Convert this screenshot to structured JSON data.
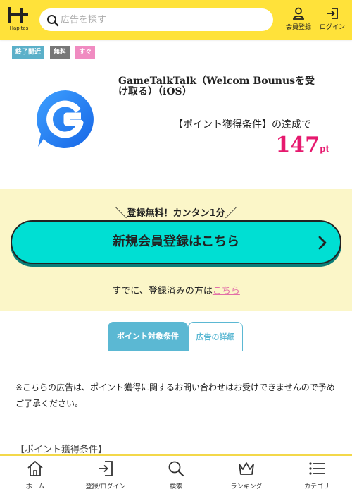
{
  "header": {
    "logo_text": "Hapitas",
    "search_placeholder": "広告を探す",
    "member_label": "会員登録",
    "login_label": "ログイン"
  },
  "badges": {
    "ending": "終了間近",
    "free": "無料",
    "instant": "すぐ"
  },
  "offer": {
    "title": "GameTalkTalk（Welcom Bounusを受け取る）（iOS）",
    "condition": "【ポイント獲得条件】の達成で",
    "points": "147",
    "unit": "pt"
  },
  "register": {
    "catch_text": "登録無料！カンタン1分",
    "slash_left": "＼",
    "slash_right": "／",
    "button_label": "新規会員登録はこちら",
    "already_text": "すでに、登録済みの方は",
    "already_link": "こちら"
  },
  "tabs": [
    {
      "label": "ポイント対象条件",
      "active": true
    },
    {
      "label": "広告の詳細",
      "active": false
    }
  ],
  "notice": "※こちらの広告は、ポイント獲得に関するお問い合わせはお受けできませんので予めご了承ください。",
  "section_heading": "【ポイント獲得条件】",
  "bottom_nav": [
    {
      "label": "ホーム",
      "icon": "home-icon"
    },
    {
      "label": "登録/ログイン",
      "icon": "login-icon"
    },
    {
      "label": "検索",
      "icon": "search-icon"
    },
    {
      "label": "ランキング",
      "icon": "crown-icon"
    },
    {
      "label": "カテゴリ",
      "icon": "list-icon"
    }
  ],
  "colors": {
    "header": "#ffe23a",
    "accent_teal": "#00dfd3",
    "points_pink": "#e6196e",
    "register_bg": "#fbf6c8",
    "tab_blue": "#5bb8d3"
  }
}
